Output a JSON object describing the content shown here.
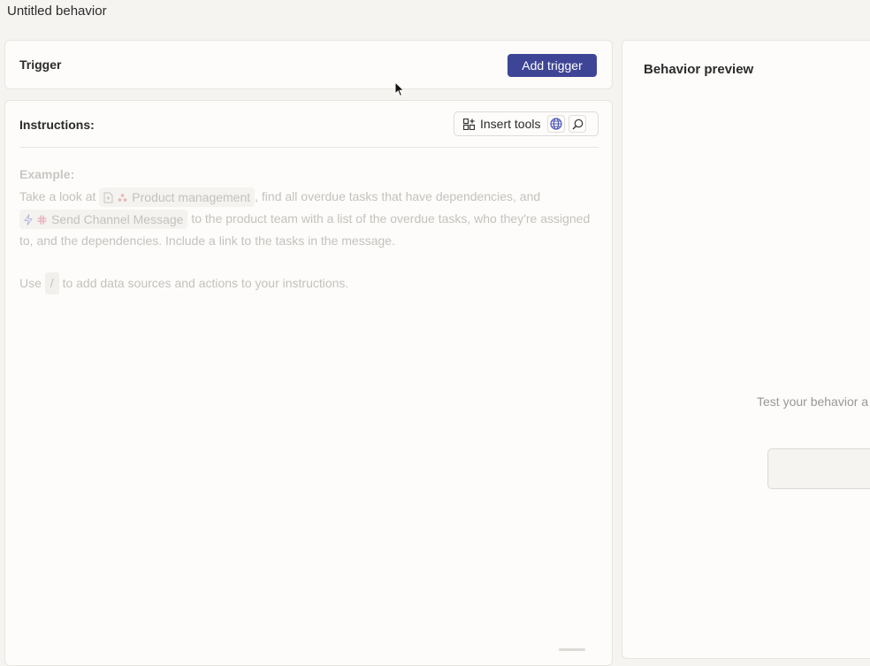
{
  "page": {
    "title": "Untitled behavior"
  },
  "trigger": {
    "label": "Trigger",
    "add_button": "Add trigger"
  },
  "instructions": {
    "label": "Instructions:",
    "insert_tools": "Insert tools",
    "example": {
      "heading": "Example:",
      "t1": "Take a look at",
      "chip1": "Product management",
      "t2": ", find all overdue tasks that have dependencies, and",
      "chip2": "Send Channel Message",
      "t3": "to the product team with a list of the overdue tasks, who they're assigned to, and the dependencies. Include a link to the tasks in the message.",
      "use_before": "Use",
      "slash": "/",
      "use_after": "to add data sources and actions to your instructions."
    }
  },
  "preview": {
    "title": "Behavior preview",
    "text": "Test your behavior a"
  },
  "colors": {
    "accent": "#3f4596",
    "background": "#f5f4f1",
    "panel": "#fdfcfa"
  },
  "icons": [
    "grid-icon",
    "globe-icon",
    "search-icon",
    "document-icon",
    "asana-icon",
    "lightning-icon",
    "slack-icon",
    "cursor-icon"
  ]
}
